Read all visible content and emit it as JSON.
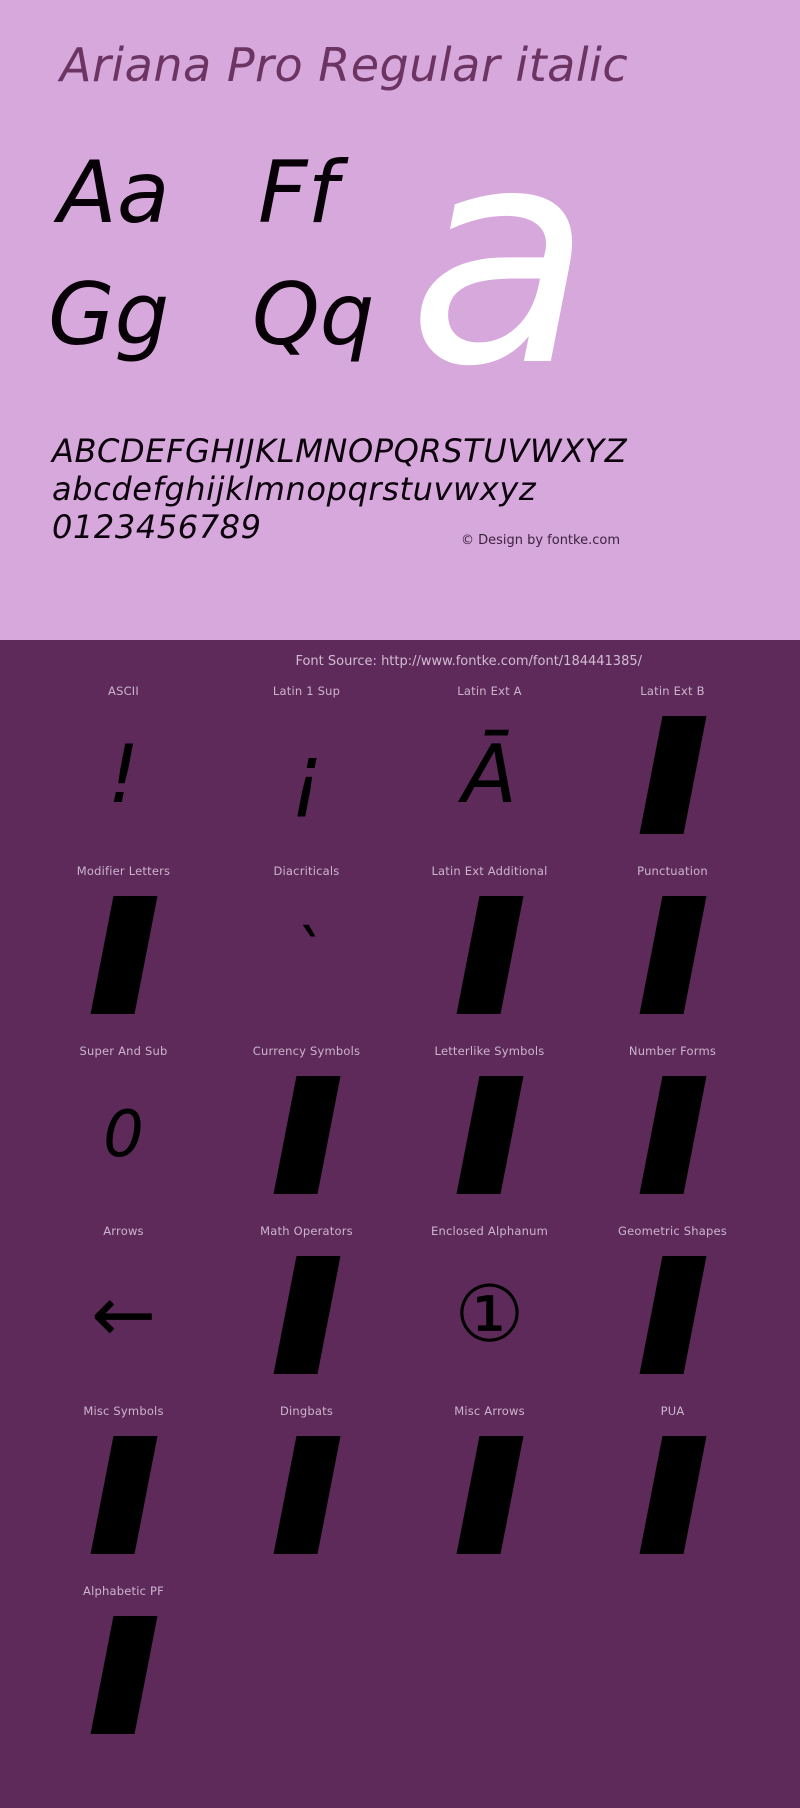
{
  "specimen": {
    "title": "Ariana Pro Regular italic",
    "letter_pairs": [
      "Aa",
      "Ff",
      "Gg",
      "Qq"
    ],
    "watermark_letter": "a",
    "alphabet_upper": "ABCDEFGHIJKLMNOPQRSTUVWXYZ",
    "alphabet_lower": "abcdefghijklmnopqrstuvwxyz",
    "digits": "0123456789",
    "copyright": "© Design by fontke.com",
    "colors": {
      "light_band": "#d6a8db",
      "dark_band": "#5d2a5a",
      "title_text": "#6b3462",
      "glyph_black": "#000000",
      "watermark_white": "#ffffff",
      "label_text": "#cdb4cd"
    }
  },
  "blocks": {
    "source_line": "Font Source: http://www.fontke.com/font/184441385/",
    "rows": [
      [
        {
          "label": "ASCII",
          "glyph": "!",
          "kind": "char"
        },
        {
          "label": "Latin 1 Sup",
          "glyph": "¡",
          "kind": "char"
        },
        {
          "label": "Latin Ext A",
          "glyph": "Ā",
          "kind": "char"
        },
        {
          "label": "Latin Ext B",
          "glyph": "",
          "kind": "notdef"
        }
      ],
      [
        {
          "label": "Modifier Letters",
          "glyph": "",
          "kind": "notdef"
        },
        {
          "label": "Diacriticals",
          "glyph": "ˋ",
          "kind": "char-small"
        },
        {
          "label": "Latin Ext Additional",
          "glyph": "",
          "kind": "notdef"
        },
        {
          "label": "Punctuation",
          "glyph": "",
          "kind": "notdef"
        }
      ],
      [
        {
          "label": "Super And Sub",
          "glyph": "0",
          "kind": "char-small"
        },
        {
          "label": "Currency Symbols",
          "glyph": "",
          "kind": "notdef"
        },
        {
          "label": "Letterlike Symbols",
          "glyph": "",
          "kind": "notdef"
        },
        {
          "label": "Number Forms",
          "glyph": "",
          "kind": "notdef"
        }
      ],
      [
        {
          "label": "Arrows",
          "glyph": "←",
          "kind": "arrow"
        },
        {
          "label": "Math Operators",
          "glyph": "",
          "kind": "notdef"
        },
        {
          "label": "Enclosed Alphanum",
          "glyph": "①",
          "kind": "circled"
        },
        {
          "label": "Geometric Shapes",
          "glyph": "",
          "kind": "notdef"
        }
      ],
      [
        {
          "label": "Misc Symbols",
          "glyph": "",
          "kind": "notdef"
        },
        {
          "label": "Dingbats",
          "glyph": "",
          "kind": "notdef"
        },
        {
          "label": "Misc Arrows",
          "glyph": "",
          "kind": "notdef"
        },
        {
          "label": "PUA",
          "glyph": "",
          "kind": "notdef"
        }
      ],
      [
        {
          "label": "Alphabetic PF",
          "glyph": "",
          "kind": "notdef"
        },
        {
          "label": "",
          "glyph": "",
          "kind": "empty"
        },
        {
          "label": "",
          "glyph": "",
          "kind": "empty"
        },
        {
          "label": "",
          "glyph": "",
          "kind": "empty"
        }
      ]
    ]
  }
}
